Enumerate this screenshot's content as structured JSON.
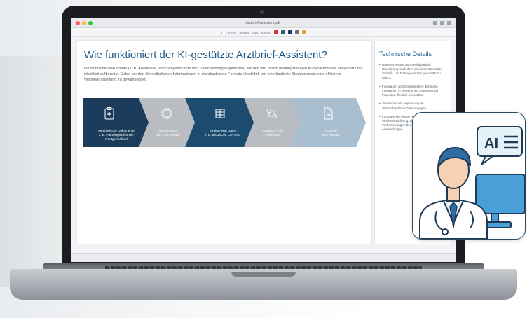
{
  "app": {
    "doc_title": "Arztbrief-Assistent.pdf",
    "toolbar_tools": [
      "T",
      "Formen",
      "Medien",
      "Link",
      "Komm."
    ],
    "colors": {
      "brand_dark": "#1b3c5a",
      "brand_mid": "#2a5c82",
      "gray": "#b9bcc0",
      "light_blue": "#a9bfd0",
      "title_blue": "#1e5a8a"
    }
  },
  "slide": {
    "title": "Wie funktioniert der KI-gestützte Arztbrief-Assistent?",
    "body": "Medizinische Dokumente (z. B. Anamnese, Pathologiebefunde und Untersuchungsergebnisse) werden von einem leistungsfähigen KI-Sprachmodell analysiert und inhaltlich aufbereitet. Dabei werden die enthaltenen Informationen in standardisierte Formate überführt, um eine fundierte Struktur sowie eine effiziente Weiterverarbeitung zu gewährleisten.",
    "steps": [
      {
        "label": "Medizinische Dokumente\nz. B. Pathologiebefunde,\nRöntgenbefund",
        "icon": "clipboard-medical-icon"
      },
      {
        "label": "Verarbeitung\ndurch KI-Modell",
        "icon": "ai-chip-icon"
      },
      {
        "label": "Strukturierte Daten\nz. B. als JSON, CSV, etc.",
        "icon": "table-icon"
      },
      {
        "label": "Extraktion und\nValidierung",
        "icon": "workflow-icon"
      },
      {
        "label": "Arztbrief\nzur Freigabe",
        "icon": "document-export-icon"
      }
    ]
  },
  "side": {
    "title": "Technische Details",
    "items": [
      "Datensicherheit und Verfügbarkeit: Umsetzung nach dem aktuellen Stand der Technik, um Daten jederzeit geschützt zu halten.",
      "Integration und Schnittstellen: Einfache Integration in bestehende Systeme und Prozesse, flexibel einsetzbar.",
      "Skalierbarkeit: Anpassung an unterschiedliche Datenmengen.",
      "Fortlaufende Pflege: Kontinuierliche Weiterentwicklung, Updates und Verbesserungen der Modelle und Anwendungen."
    ]
  },
  "card": {
    "badge": "AI"
  }
}
